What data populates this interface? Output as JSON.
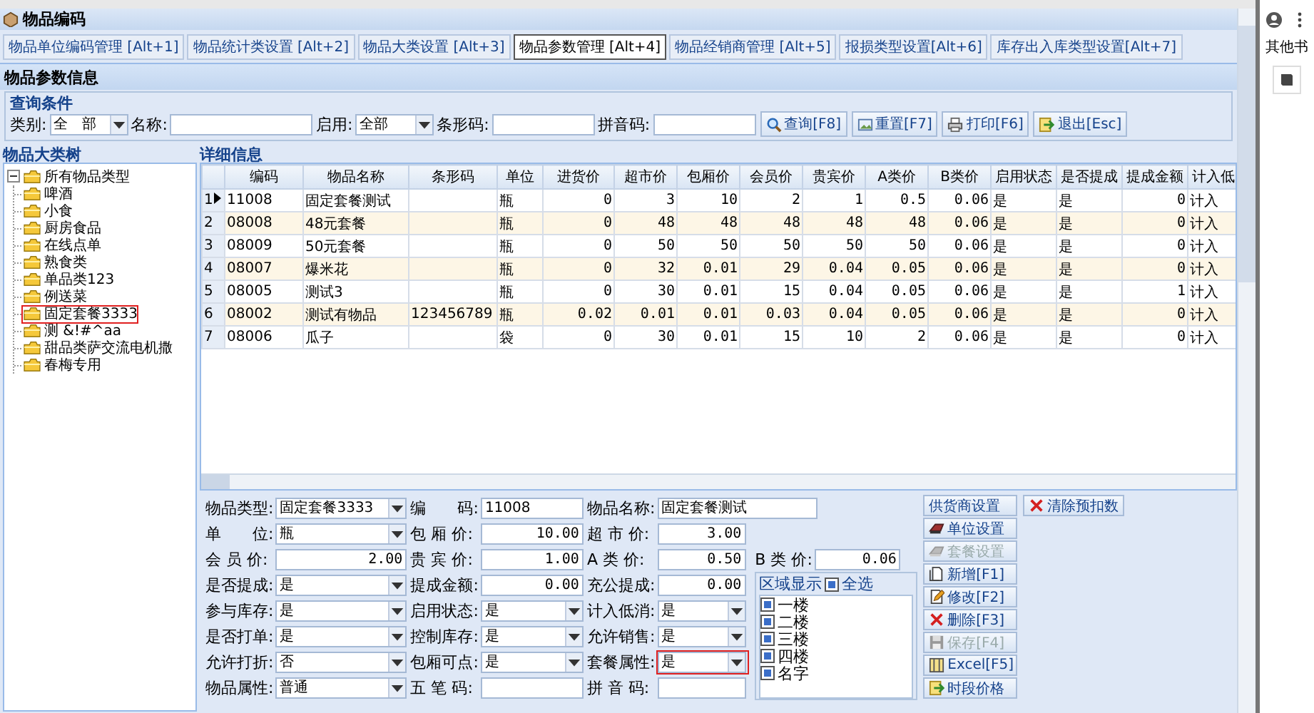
{
  "window": {
    "title": "物品编码"
  },
  "tabs": [
    {
      "label": "物品单位编码管理 [Alt+1]",
      "selected": false
    },
    {
      "label": "物品统计类设置 [Alt+2]",
      "selected": false
    },
    {
      "label": "物品大类设置 [Alt+3]",
      "selected": false
    },
    {
      "label": "物品参数管理 [Alt+4]",
      "selected": true
    },
    {
      "label": "物品经销商管理 [Alt+5]",
      "selected": false
    },
    {
      "label": "报损类型设置[Alt+6]",
      "selected": false
    },
    {
      "label": "库存出入库类型设置[Alt+7]",
      "selected": false
    }
  ],
  "section_title": "物品参数信息",
  "query": {
    "title": "查询条件",
    "fields": [
      {
        "kind": "combo",
        "label": "类别:",
        "value": "全　部"
      },
      {
        "kind": "text",
        "label": "名称:"
      },
      {
        "kind": "combo",
        "label": "启用:",
        "value": "全部"
      },
      {
        "kind": "text",
        "label": "条形码:"
      },
      {
        "kind": "text",
        "label": "拼音码:"
      }
    ],
    "buttons": [
      {
        "kind": "search",
        "label": "查询[F8]"
      },
      {
        "kind": "reset",
        "label": "重置[F7]"
      },
      {
        "kind": "print",
        "label": "打印[F6]"
      },
      {
        "kind": "exit",
        "label": "退出[Esc]"
      }
    ]
  },
  "tree": {
    "title": "物品大类树",
    "root": {
      "label": "所有物品类型",
      "expanded": true,
      "children": [
        {
          "label": "啤酒",
          "highlighted": false
        },
        {
          "label": "小食",
          "highlighted": false
        },
        {
          "label": "厨房食品",
          "highlighted": false
        },
        {
          "label": "在线点单",
          "highlighted": false
        },
        {
          "label": "熟食类",
          "highlighted": false
        },
        {
          "label": "单品类123",
          "highlighted": false
        },
        {
          "label": "例送菜",
          "highlighted": false
        },
        {
          "label": "固定套餐3333",
          "highlighted": true
        },
        {
          "label": "测 &!#^aa",
          "highlighted": false
        },
        {
          "label": "甜品类萨交流电机撒",
          "highlighted": false
        },
        {
          "label": "春梅专用",
          "highlighted": false
        }
      ]
    }
  },
  "detail": {
    "title": "详细信息",
    "columns": [
      {
        "label": "编码",
        "kind": "text"
      },
      {
        "label": "物品名称",
        "kind": "text"
      },
      {
        "label": "条形码",
        "kind": "text"
      },
      {
        "label": "单位",
        "kind": "text"
      },
      {
        "label": "进货价",
        "kind": "number"
      },
      {
        "label": "超市价",
        "kind": "number"
      },
      {
        "label": "包厢价",
        "kind": "number"
      },
      {
        "label": "会员价",
        "kind": "number"
      },
      {
        "label": "贵宾价",
        "kind": "number"
      },
      {
        "label": "A类价",
        "kind": "number"
      },
      {
        "label": "B类价",
        "kind": "number"
      },
      {
        "label": "启用状态",
        "kind": "text"
      },
      {
        "label": "是否提成",
        "kind": "text"
      },
      {
        "label": "提成金额",
        "kind": "number"
      },
      {
        "label": "计入低",
        "kind": "text"
      }
    ],
    "rows": [
      {
        "number": "1",
        "selected": true,
        "cells": [
          "11008",
          "固定套餐测试",
          "",
          "瓶",
          "0",
          "3",
          "10",
          "2",
          "1",
          "0.5",
          "0.06",
          "是",
          "是",
          "0",
          "计入"
        ]
      },
      {
        "number": "2",
        "selected": false,
        "cells": [
          "08008",
          "48元套餐",
          "",
          "瓶",
          "0",
          "48",
          "48",
          "48",
          "48",
          "48",
          "0.06",
          "是",
          "是",
          "0",
          "计入"
        ]
      },
      {
        "number": "3",
        "selected": false,
        "cells": [
          "08009",
          "50元套餐",
          "",
          "瓶",
          "0",
          "50",
          "50",
          "50",
          "50",
          "50",
          "0.06",
          "是",
          "是",
          "0",
          "计入"
        ]
      },
      {
        "number": "4",
        "selected": false,
        "cells": [
          "08007",
          "爆米花",
          "",
          "瓶",
          "0",
          "32",
          "0.01",
          "29",
          "0.04",
          "0.05",
          "0.06",
          "是",
          "是",
          "0",
          "计入"
        ]
      },
      {
        "number": "5",
        "selected": false,
        "cells": [
          "08005",
          "测试3",
          "",
          "瓶",
          "0",
          "30",
          "0.01",
          "15",
          "0.04",
          "0.05",
          "0.06",
          "是",
          "是",
          "1",
          "计入"
        ]
      },
      {
        "number": "6",
        "selected": false,
        "cells": [
          "08002",
          "测试有物品",
          "123456789",
          "瓶",
          "0.02",
          "0.01",
          "0.01",
          "0.03",
          "0.04",
          "0.05",
          "0.06",
          "是",
          "是",
          "0",
          "计入"
        ]
      },
      {
        "number": "7",
        "selected": false,
        "cells": [
          "08006",
          "瓜子",
          "",
          "袋",
          "0",
          "30",
          "0.01",
          "15",
          "10",
          "2",
          "0.06",
          "是",
          "是",
          "0",
          "计入"
        ]
      }
    ]
  },
  "form": {
    "rows": [
      [
        {
          "kind": "combo",
          "label": "物品类型:",
          "value": "固定套餐3333",
          "highlighted": false
        },
        {
          "kind": "text",
          "label": "编　　码:",
          "value": "11008",
          "highlighted": false
        },
        {
          "kind": "text",
          "label": "物品名称:",
          "value": "固定套餐测试",
          "highlighted": false
        }
      ],
      [
        {
          "kind": "combo",
          "label": "单　　位:",
          "value": "瓶",
          "highlighted": false
        },
        {
          "kind": "number",
          "label": "包 厢 价:",
          "value": "10.00",
          "highlighted": false
        },
        {
          "kind": "number",
          "label": "超 市 价:",
          "value": "3.00",
          "highlighted": false
        }
      ],
      [
        {
          "kind": "number",
          "label": "会 员 价:",
          "value": "2.00",
          "highlighted": false
        },
        {
          "kind": "number",
          "label": "贵 宾 价:",
          "value": "1.00",
          "highlighted": false
        },
        {
          "kind": "number",
          "label": "A 类 价:",
          "value": "0.50",
          "highlighted": false
        }
      ],
      [
        {
          "kind": "combo",
          "label": "是否提成:",
          "value": "是",
          "highlighted": false
        },
        {
          "kind": "number",
          "label": "提成金额:",
          "value": "0.00",
          "highlighted": false
        },
        {
          "kind": "number",
          "label": "充公提成:",
          "value": "0.00",
          "highlighted": false
        }
      ],
      [
        {
          "kind": "combo",
          "label": "参与库存:",
          "value": "是",
          "highlighted": false
        },
        {
          "kind": "combo",
          "label": "启用状态:",
          "value": "是",
          "highlighted": false
        },
        {
          "kind": "combo",
          "label": "计入低消:",
          "value": "是",
          "highlighted": false
        }
      ],
      [
        {
          "kind": "combo",
          "label": "是否打单:",
          "value": "是",
          "highlighted": false
        },
        {
          "kind": "combo",
          "label": "控制库存:",
          "value": "是",
          "highlighted": false
        },
        {
          "kind": "combo",
          "label": "允许销售:",
          "value": "是",
          "highlighted": false
        }
      ],
      [
        {
          "kind": "combo",
          "label": "允许打折:",
          "value": "否",
          "highlighted": false
        },
        {
          "kind": "combo",
          "label": "包厢可点:",
          "value": "是",
          "highlighted": false
        },
        {
          "kind": "combo",
          "label": "套餐属性:",
          "value": "是",
          "highlighted": true
        }
      ],
      [
        {
          "kind": "combo",
          "label": "物品属性:",
          "value": "普通",
          "highlighted": false
        },
        {
          "kind": "text",
          "label": "五 笔 码:",
          "highlighted": false
        },
        {
          "kind": "text",
          "label": "拼 音 码:",
          "highlighted": false
        }
      ]
    ],
    "b_price": {
      "label": "B 类 价:",
      "value": "0.06"
    },
    "area": {
      "title": "区域显示",
      "select_all": {
        "label": "全选",
        "checked": true
      },
      "items": [
        {
          "label": "一楼",
          "checked": true
        },
        {
          "label": "二楼",
          "checked": true
        },
        {
          "label": "三楼",
          "checked": true
        },
        {
          "label": "四楼",
          "checked": true
        },
        {
          "label": "名字",
          "checked": true
        }
      ]
    },
    "buttons": [
      {
        "kind": "plain",
        "label": "供货商设置",
        "disabled": false
      },
      {
        "kind": "unit",
        "label": "单位设置",
        "disabled": false
      },
      {
        "kind": "unit",
        "label": "套餐设置",
        "disabled": true
      },
      {
        "kind": "new",
        "label": "新增[F1]",
        "disabled": false
      },
      {
        "kind": "edit",
        "label": "修改[F2]",
        "disabled": false
      },
      {
        "kind": "delete",
        "label": "删除[F3]",
        "disabled": false
      },
      {
        "kind": "save",
        "label": "保存[F4]",
        "disabled": true
      },
      {
        "kind": "excel",
        "label": "Excel[F5]",
        "disabled": false
      },
      {
        "kind": "exit",
        "label": "时段价格",
        "disabled": false
      }
    ],
    "clear_button": {
      "kind": "delete",
      "label": "清除预扣数",
      "disabled": false
    }
  },
  "browser_side": {
    "bookmarks": "其他书"
  }
}
